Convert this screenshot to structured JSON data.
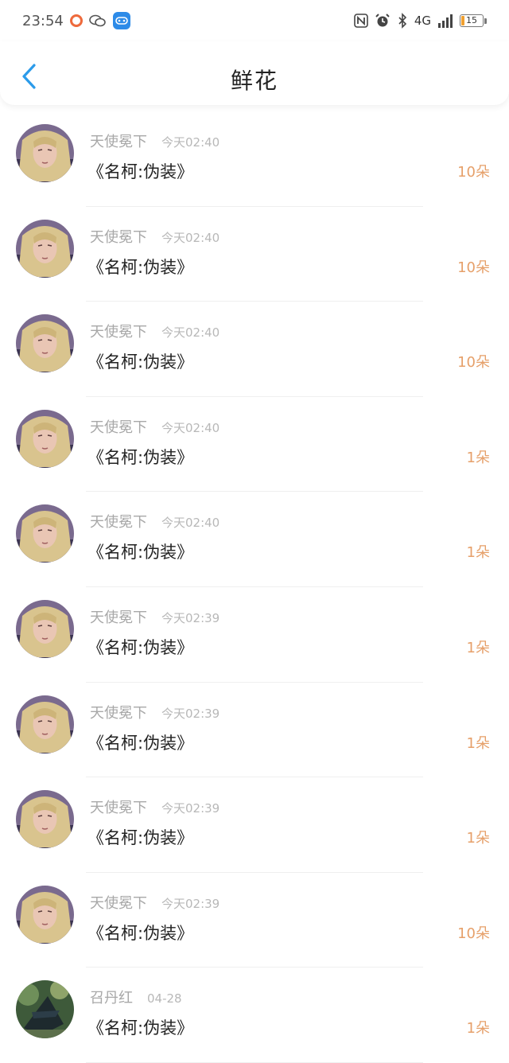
{
  "status_bar": {
    "time": "23:54",
    "network": "4G",
    "battery": "15",
    "battery_level": 0.15
  },
  "header": {
    "title": "鲜花",
    "back_icon": "chevron-left-icon"
  },
  "items": [
    {
      "name": "天使冕下",
      "time": "今天02:40",
      "book": "《名柯:伪装》",
      "count": "10朵",
      "avatar": "blonde-male-avatar"
    },
    {
      "name": "天使冕下",
      "time": "今天02:40",
      "book": "《名柯:伪装》",
      "count": "10朵",
      "avatar": "blonde-male-avatar"
    },
    {
      "name": "天使冕下",
      "time": "今天02:40",
      "book": "《名柯:伪装》",
      "count": "10朵",
      "avatar": "blonde-male-avatar"
    },
    {
      "name": "天使冕下",
      "time": "今天02:40",
      "book": "《名柯:伪装》",
      "count": "1朵",
      "avatar": "blonde-male-avatar"
    },
    {
      "name": "天使冕下",
      "time": "今天02:40",
      "book": "《名柯:伪装》",
      "count": "1朵",
      "avatar": "blonde-male-avatar"
    },
    {
      "name": "天使冕下",
      "time": "今天02:39",
      "book": "《名柯:伪装》",
      "count": "1朵",
      "avatar": "blonde-male-avatar"
    },
    {
      "name": "天使冕下",
      "time": "今天02:39",
      "book": "《名柯:伪装》",
      "count": "1朵",
      "avatar": "blonde-male-avatar"
    },
    {
      "name": "天使冕下",
      "time": "今天02:39",
      "book": "《名柯:伪装》",
      "count": "1朵",
      "avatar": "blonde-male-avatar"
    },
    {
      "name": "天使冕下",
      "time": "今天02:39",
      "book": "《名柯:伪装》",
      "count": "10朵",
      "avatar": "blonde-male-avatar"
    },
    {
      "name": "召丹红",
      "time": "04-28",
      "book": "《名柯:伪装》",
      "count": "1朵",
      "avatar": "dark-scene-avatar"
    }
  ]
}
